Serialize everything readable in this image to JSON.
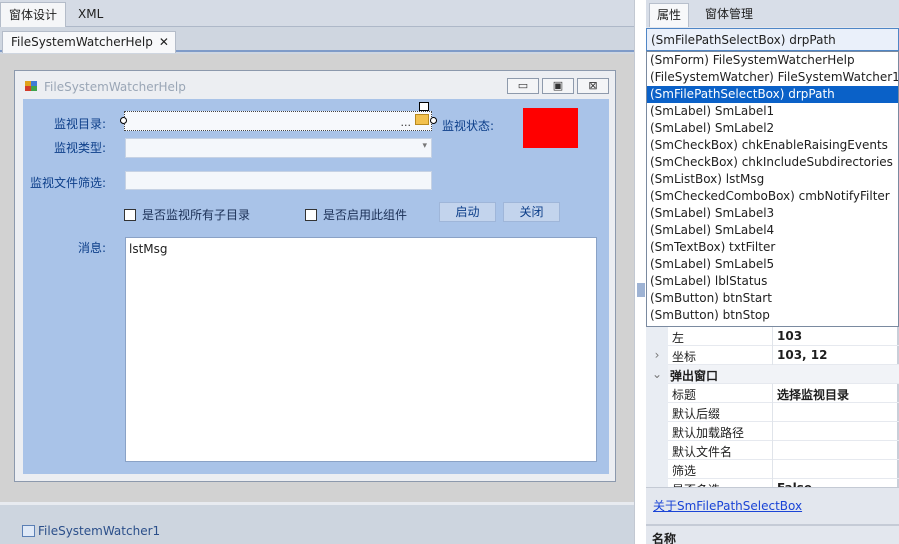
{
  "top_tabs": [
    "窗体设计",
    "XML"
  ],
  "doc_tab": {
    "title": "FileSystemWatcherHelp",
    "close": "✕"
  },
  "window": {
    "title": "FileSystemWatcherHelp",
    "min": "▭",
    "max": "▣",
    "close": "⊠"
  },
  "form": {
    "dir_label": "监视目录:",
    "dir_ellipsis": "...",
    "status_label": "监视状态:",
    "status_color": "#ff0000",
    "type_label": "监视类型:",
    "filter_label": "监视文件筛选:",
    "chk_subdirs": "是否监视所有子目录",
    "chk_enable": "是否启用此组件",
    "btn_start": "启动",
    "btn_stop": "关闭",
    "msg_label": "消息:",
    "list_text": "lstMsg"
  },
  "tray": {
    "item": "FileSystemWatcher1"
  },
  "right": {
    "tabs": [
      "属性",
      "窗体管理"
    ],
    "combo_value": "(SmFilePathSelectBox) drpPath",
    "dropdown_items": [
      "(SmForm) FileSystemWatcherHelp",
      "(FileSystemWatcher) FileSystemWatcher1",
      "(SmFilePathSelectBox) drpPath",
      "(SmLabel) SmLabel1",
      "(SmLabel) SmLabel2",
      "(SmCheckBox) chkEnableRaisingEvents",
      "(SmCheckBox) chkIncludeSubdirectories",
      "(SmListBox) lstMsg",
      "(SmCheckedComboBox) cmbNotifyFilter",
      "(SmLabel) SmLabel3",
      "(SmLabel) SmLabel4",
      "(SmTextBox) txtFilter",
      "(SmLabel) SmLabel5",
      "(SmLabel) lblStatus",
      "(SmButton) btnStart",
      "(SmButton) btnStop"
    ],
    "selected_index": 2,
    "properties": [
      {
        "name": "左",
        "value": "103",
        "kind": "prop",
        "gutter": ""
      },
      {
        "name": "坐标",
        "value": "103, 12",
        "kind": "prop",
        "gutter": "›"
      },
      {
        "name": "弹出窗口",
        "value": "",
        "kind": "cat",
        "gutter": "⌄"
      },
      {
        "name": "标题",
        "value": "选择监视目录",
        "kind": "prop",
        "gutter": ""
      },
      {
        "name": "默认后缀",
        "value": "",
        "kind": "prop",
        "gutter": ""
      },
      {
        "name": "默认加载路径",
        "value": "",
        "kind": "prop",
        "gutter": ""
      },
      {
        "name": "默认文件名",
        "value": "",
        "kind": "prop",
        "gutter": ""
      },
      {
        "name": "筛选",
        "value": "",
        "kind": "prop",
        "gutter": ""
      },
      {
        "name": "是否多选",
        "value": "False",
        "kind": "prop",
        "gutter": ""
      }
    ],
    "desc_link": "关于SmFilePathSelectBox",
    "desc_name": "名称"
  }
}
